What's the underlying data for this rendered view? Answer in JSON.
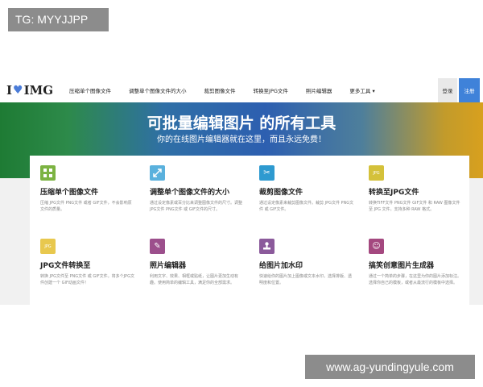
{
  "watermarks": {
    "top": "TG: MYYJJPP",
    "bottom": "www.ag-yundingyule.com"
  },
  "navbar": {
    "logo": {
      "pre": "I",
      "heart": "♥",
      "post": "IMG"
    },
    "links": [
      "压缩单个图像文件",
      "调整单个图像文件的大小",
      "裁剪图像文件",
      "转换至JPG文件",
      "照片编辑器",
      "更多工具 ▾"
    ],
    "login": "登录",
    "register": "注册"
  },
  "hero": {
    "title": "可批量编辑图片 的所有工具",
    "subtitle": "你的在线图片编辑器就在这里，而且永远免费！"
  },
  "tools": [
    {
      "name": "压缩单个图像文件",
      "desc": "压缩 JPG文件 PNG文件 或者 GIF文件，不会影响原文件的质量。",
      "icon": "compress-icon",
      "color": "#7cb342"
    },
    {
      "name": "调整单个图像文件的大小",
      "desc": "通过设定像素或百分比来调整图像文件的尺寸。调整 JPG文件 PNG文件 或 GIF文件的尺寸。",
      "icon": "resize-icon",
      "color": "#5ab1dd"
    },
    {
      "name": "裁剪图像文件",
      "desc": "通过设定像素来裁剪图像文件。裁剪 JPG文件 PNG文件 或 GIF文件。",
      "icon": "scissors-icon",
      "color": "#2e9ad0"
    },
    {
      "name": "转换至JPG文件",
      "desc": "转换TIFF文件 PNG文件 GIF文件 和 RAW 图像文件至 JPG 文件。支持多种 RAW 格式。",
      "icon": "jpg-icon",
      "color": "#d4c13a"
    },
    {
      "name": "JPG文件转换至",
      "desc": "转换 JPG文件至 PNG文件 或 GIF文件。将多个JPG文件创建一个 GIF动画文件！",
      "icon": "jpg-file-icon",
      "color": "#e8c84e"
    },
    {
      "name": "照片编辑器",
      "desc": "利用文字、效果、相框或贴纸，让图片更加生动有趣。使用简单的编辑工具，满足你的全部需求。",
      "icon": "pencil-icon",
      "color": "#9c4f8c"
    },
    {
      "name": "给图片加水印",
      "desc": "快速给你的图片加上图像或文本水印。选择排版、透明度和位置。",
      "icon": "stamp-icon",
      "color": "#8b5a9b"
    },
    {
      "name": "搞笑创意图片生成器",
      "desc": "通过一个简单的步骤，在这里为你的图片添加标注。选择你自己的模板，或者从最流行的模板中选择。",
      "icon": "smiley-icon",
      "color": "#a4487f"
    }
  ]
}
